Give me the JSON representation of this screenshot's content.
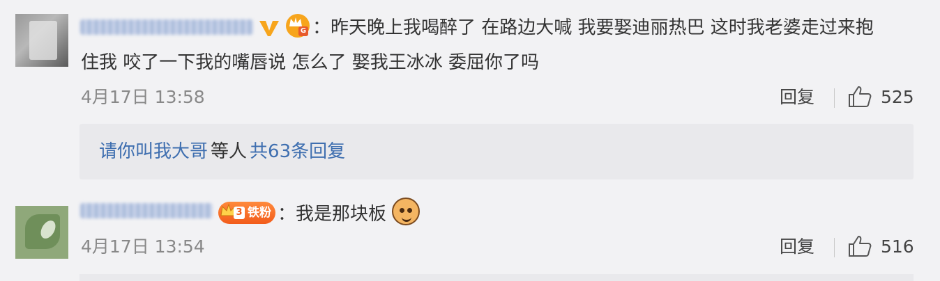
{
  "comments": [
    {
      "text_line1": "：昨天晚上我喝醉了 在路边大喊 我要娶迪丽热巴 这时我老婆走过来抱",
      "text_line2": "住我 咬了一下我的嘴唇说 怎么了 娶我王冰冰 委屈你了吗",
      "timestamp": "4月17日 13:58",
      "reply_label": "回复",
      "likes": "525",
      "replies_preview": {
        "user": "请你叫我大哥",
        "middle": "等人",
        "more": "共63条回复"
      }
    },
    {
      "badge_level": "3",
      "badge_label": "铁粉",
      "text": "：我是那块板",
      "timestamp": "4月17日 13:54",
      "reply_label": "回复",
      "likes": "516"
    }
  ],
  "colors": {
    "background": "#f2f2f4",
    "link": "#3f6fb0",
    "badge": "#f25c1b"
  },
  "icons": [
    "verified-v-icon",
    "crown-badge-icon",
    "fan-badge-icon",
    "emoji-face-icon",
    "thumbs-up-icon"
  ]
}
